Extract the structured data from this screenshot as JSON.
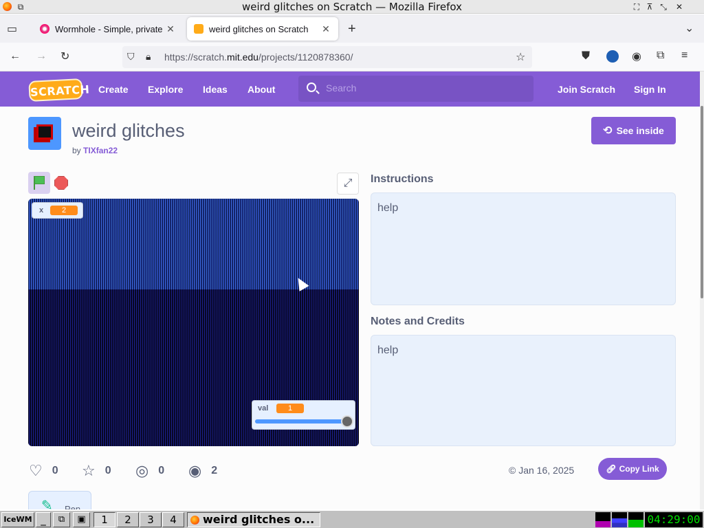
{
  "window": {
    "title": "weird glitches on Scratch — Mozilla Firefox"
  },
  "tabs": [
    {
      "label": "Wormhole - Simple, private",
      "active": false
    },
    {
      "label": "weird glitches on Scratch",
      "active": true
    }
  ],
  "address_bar": {
    "url_prefix": "https://scratch.",
    "url_domain": "mit.edu",
    "url_path": "/projects/1120878360/"
  },
  "scratch_nav": {
    "logo": "SCRATCH",
    "links": [
      "Create",
      "Explore",
      "Ideas",
      "About"
    ],
    "search_placeholder": "Search",
    "join": "Join Scratch",
    "signin": "Sign In"
  },
  "project": {
    "title": "weird glitches",
    "by_prefix": "by",
    "author": "TIXfan22",
    "see_inside": "See inside"
  },
  "stage": {
    "monitor_x": {
      "label": "x",
      "value": "2"
    },
    "monitor_val": {
      "label": "val",
      "value": "1",
      "slider_fraction": 1.0
    }
  },
  "instructions": {
    "title": "Instructions",
    "text": "help"
  },
  "notes": {
    "title": "Notes and Credits",
    "text": "help"
  },
  "stats": {
    "loves": "0",
    "favorites": "0",
    "remixes": "0",
    "views": "2"
  },
  "date": "Jan 16, 2025",
  "copy_link": "Copy Link",
  "extension_card": "Pen",
  "taskbar": {
    "workspaces": [
      "1",
      "2",
      "3",
      "4"
    ],
    "window_label": "weird glitches o...",
    "clock": "04:29:00"
  },
  "colors": {
    "scratch_purple": "#855cd6",
    "monitor_orange": "#ff8c1a"
  }
}
